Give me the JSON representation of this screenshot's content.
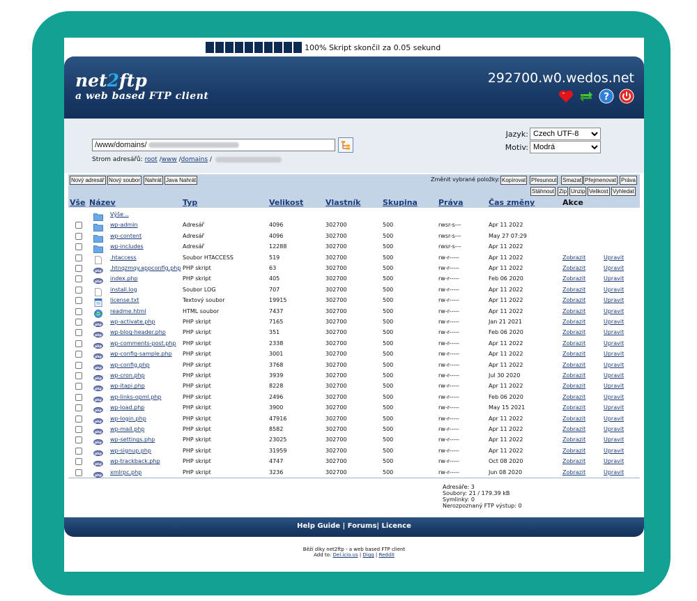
{
  "progress": {
    "text": "100% Skript skončil za 0.05 sekund",
    "percent": 100
  },
  "header": {
    "logo_name_a": "net",
    "logo_name_b": "2",
    "logo_name_c": "ftp",
    "logo_tagline": "a web based FTP client",
    "host": "292700.w0.wedos.net"
  },
  "nav": {
    "directory_value": "/www/domains/",
    "tree_label": "Strom adresářů:",
    "tree_root": "root",
    "tree_sep": " /",
    "tree_www": "www",
    "tree_domains": "domains",
    "language_label": "Jazyk:",
    "language_value": "Czech UTF-8",
    "theme_label": "Motiv:",
    "theme_value": "Modrá"
  },
  "actions": {
    "new_dir": "Nový adresář",
    "new_file": "Nový soubor",
    "upload": "Nahrát",
    "java_upload": "Java Nahrát",
    "change_label": "Změnit vybrané položky:",
    "copy": "Kopírovat",
    "move": "Přesunout",
    "delete": "Smazat",
    "rename": "Přejmenovat",
    "rights": "Práva",
    "download": "Stáhnout",
    "zip": "Zip",
    "unzip": "Unzip",
    "size": "Velikost",
    "search": "Vyhledat"
  },
  "table": {
    "headers": {
      "all": "Vše",
      "name": "Název",
      "type": "Typ",
      "size": "Velikost",
      "owner": "Vlastník",
      "group": "Skupina",
      "rights": "Práva",
      "mtime": "Čas změny",
      "actions": "Akce"
    },
    "up_label": "Výše ..",
    "view_label": "Zobrazit",
    "edit_label": "Upravit",
    "rows": [
      {
        "name": "wp-admin",
        "type": "Adresář",
        "size": "4096",
        "owner": "302700",
        "group": "500",
        "rights": "rwsr-s---",
        "mtime": "Apr 11 2022",
        "icon": "folder-icon",
        "actions": false
      },
      {
        "name": "wp-content",
        "type": "Adresář",
        "size": "4096",
        "owner": "302700",
        "group": "500",
        "rights": "rwsr-s---",
        "mtime": "May 27 07:29",
        "icon": "folder-icon",
        "actions": false
      },
      {
        "name": "wp-includes",
        "type": "Adresář",
        "size": "12288",
        "owner": "302700",
        "group": "500",
        "rights": "rwsr-s---",
        "mtime": "Apr 11 2022",
        "icon": "folder-icon",
        "actions": false
      },
      {
        "name": ".htaccess",
        "type": "Soubor HTACCESS",
        "size": "519",
        "owner": "302700",
        "group": "500",
        "rights": "rw-r-----",
        "mtime": "Apr 11 2022",
        "icon": "file-icon",
        "actions": true
      },
      {
        "name": ".htnqzmqy.appconfig.php",
        "type": "PHP skript",
        "size": "63",
        "owner": "302700",
        "group": "500",
        "rights": "rw-r-----",
        "mtime": "Apr 11 2022",
        "icon": "php-icon",
        "actions": true
      },
      {
        "name": "index.php",
        "type": "PHP skript",
        "size": "405",
        "owner": "302700",
        "group": "500",
        "rights": "rw-r-----",
        "mtime": "Feb 06 2020",
        "icon": "php-icon",
        "actions": true
      },
      {
        "name": "install.log",
        "type": "Soubor LOG",
        "size": "707",
        "owner": "302700",
        "group": "500",
        "rights": "rw-r-----",
        "mtime": "Apr 11 2022",
        "icon": "file-icon",
        "actions": true
      },
      {
        "name": "license.txt",
        "type": "Textový soubor",
        "size": "19915",
        "owner": "302700",
        "group": "500",
        "rights": "rw-r-----",
        "mtime": "Apr 11 2022",
        "icon": "text-file-icon",
        "actions": true
      },
      {
        "name": "readme.html",
        "type": "HTML soubor",
        "size": "7437",
        "owner": "302700",
        "group": "500",
        "rights": "rw-r-----",
        "mtime": "Apr 11 2022",
        "icon": "html-icon",
        "actions": true
      },
      {
        "name": "wp-activate.php",
        "type": "PHP skript",
        "size": "7165",
        "owner": "302700",
        "group": "500",
        "rights": "rw-r-----",
        "mtime": "Jan 21 2021",
        "icon": "php-icon",
        "actions": true
      },
      {
        "name": "wp-blog-header.php",
        "type": "PHP skript",
        "size": "351",
        "owner": "302700",
        "group": "500",
        "rights": "rw-r-----",
        "mtime": "Feb 06 2020",
        "icon": "php-icon",
        "actions": true
      },
      {
        "name": "wp-comments-post.php",
        "type": "PHP skript",
        "size": "2338",
        "owner": "302700",
        "group": "500",
        "rights": "rw-r-----",
        "mtime": "Apr 11 2022",
        "icon": "php-icon",
        "actions": true
      },
      {
        "name": "wp-config-sample.php",
        "type": "PHP skript",
        "size": "3001",
        "owner": "302700",
        "group": "500",
        "rights": "rw-r-----",
        "mtime": "Apr 11 2022",
        "icon": "php-icon",
        "actions": true
      },
      {
        "name": "wp-config.php",
        "type": "PHP skript",
        "size": "3768",
        "owner": "302700",
        "group": "500",
        "rights": "rw-r-----",
        "mtime": "Apr 11 2022",
        "icon": "php-icon",
        "actions": true
      },
      {
        "name": "wp-cron.php",
        "type": "PHP skript",
        "size": "3939",
        "owner": "302700",
        "group": "500",
        "rights": "rw-r-----",
        "mtime": "Jul 30 2020",
        "icon": "php-icon",
        "actions": true
      },
      {
        "name": "wp-itapi.php",
        "type": "PHP skript",
        "size": "8228",
        "owner": "302700",
        "group": "500",
        "rights": "rw-r-----",
        "mtime": "Apr 11 2022",
        "icon": "php-icon",
        "actions": true
      },
      {
        "name": "wp-links-opml.php",
        "type": "PHP skript",
        "size": "2496",
        "owner": "302700",
        "group": "500",
        "rights": "rw-r-----",
        "mtime": "Feb 06 2020",
        "icon": "php-icon",
        "actions": true
      },
      {
        "name": "wp-load.php",
        "type": "PHP skript",
        "size": "3900",
        "owner": "302700",
        "group": "500",
        "rights": "rw-r-----",
        "mtime": "May 15 2021",
        "icon": "php-icon",
        "actions": true
      },
      {
        "name": "wp-login.php",
        "type": "PHP skript",
        "size": "47916",
        "owner": "302700",
        "group": "500",
        "rights": "rw-r-----",
        "mtime": "Apr 11 2022",
        "icon": "php-icon",
        "actions": true
      },
      {
        "name": "wp-mail.php",
        "type": "PHP skript",
        "size": "8582",
        "owner": "302700",
        "group": "500",
        "rights": "rw-r-----",
        "mtime": "Apr 11 2022",
        "icon": "php-icon",
        "actions": true
      },
      {
        "name": "wp-settings.php",
        "type": "PHP skript",
        "size": "23025",
        "owner": "302700",
        "group": "500",
        "rights": "rw-r-----",
        "mtime": "Apr 11 2022",
        "icon": "php-icon",
        "actions": true
      },
      {
        "name": "wp-signup.php",
        "type": "PHP skript",
        "size": "31959",
        "owner": "302700",
        "group": "500",
        "rights": "rw-r-----",
        "mtime": "Apr 11 2022",
        "icon": "php-icon",
        "actions": true
      },
      {
        "name": "wp-trackback.php",
        "type": "PHP skript",
        "size": "4747",
        "owner": "302700",
        "group": "500",
        "rights": "rw-r-----",
        "mtime": "Oct 08 2020",
        "icon": "php-icon",
        "actions": true
      },
      {
        "name": "xmlrpc.php",
        "type": "PHP skript",
        "size": "3236",
        "owner": "302700",
        "group": "500",
        "rights": "rw-r-----",
        "mtime": "Jun 08 2020",
        "icon": "php-icon",
        "actions": true
      }
    ]
  },
  "summary": {
    "dirs": "Adresáře: 3",
    "files": "Soubory: 21 / 179.39 kB",
    "symlinks": "Symlinky: 0",
    "unrecognized": "Nerozpoznaný FTP výstup: 0"
  },
  "footer": {
    "help": "Help Guide",
    "forums": "Forums",
    "licence": "Licence",
    "credit": "Běží díky net2ftp - a web based FTP client",
    "add_to": "Add to:",
    "delicious": "Del.icio.us",
    "digg": "Digg",
    "reddit": "Reddit"
  },
  "colors": {
    "frame": "#12a193",
    "header": "#1b3c68",
    "bar": "#c4d3e6",
    "link": "#1b3c7a"
  }
}
